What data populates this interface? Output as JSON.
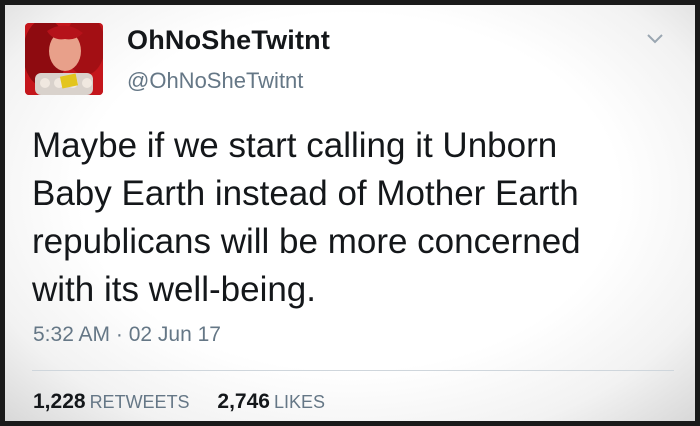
{
  "tweet": {
    "author": {
      "display_name": "OhNoSheTwitnt",
      "handle": "@OhNoSheTwitnt",
      "avatar_icon": "profile-photo-red"
    },
    "menu_icon": "chevron-down-icon",
    "text_lines": [
      "Maybe if we start calling it Unborn",
      "Baby Earth instead of Mother Earth",
      "republicans will be more concerned",
      "with its well-being."
    ],
    "timestamp": "5:32 AM · 02 Jun 17",
    "stats": {
      "retweets": {
        "count": "1,228",
        "label": "RETWEETS"
      },
      "likes": {
        "count": "2,746",
        "label": "LIKES"
      }
    }
  },
  "colors": {
    "name_text": "#14171a",
    "secondary_text": "#657786",
    "divider": "#cfd6dc",
    "avatar_bg": "#c4161c"
  }
}
